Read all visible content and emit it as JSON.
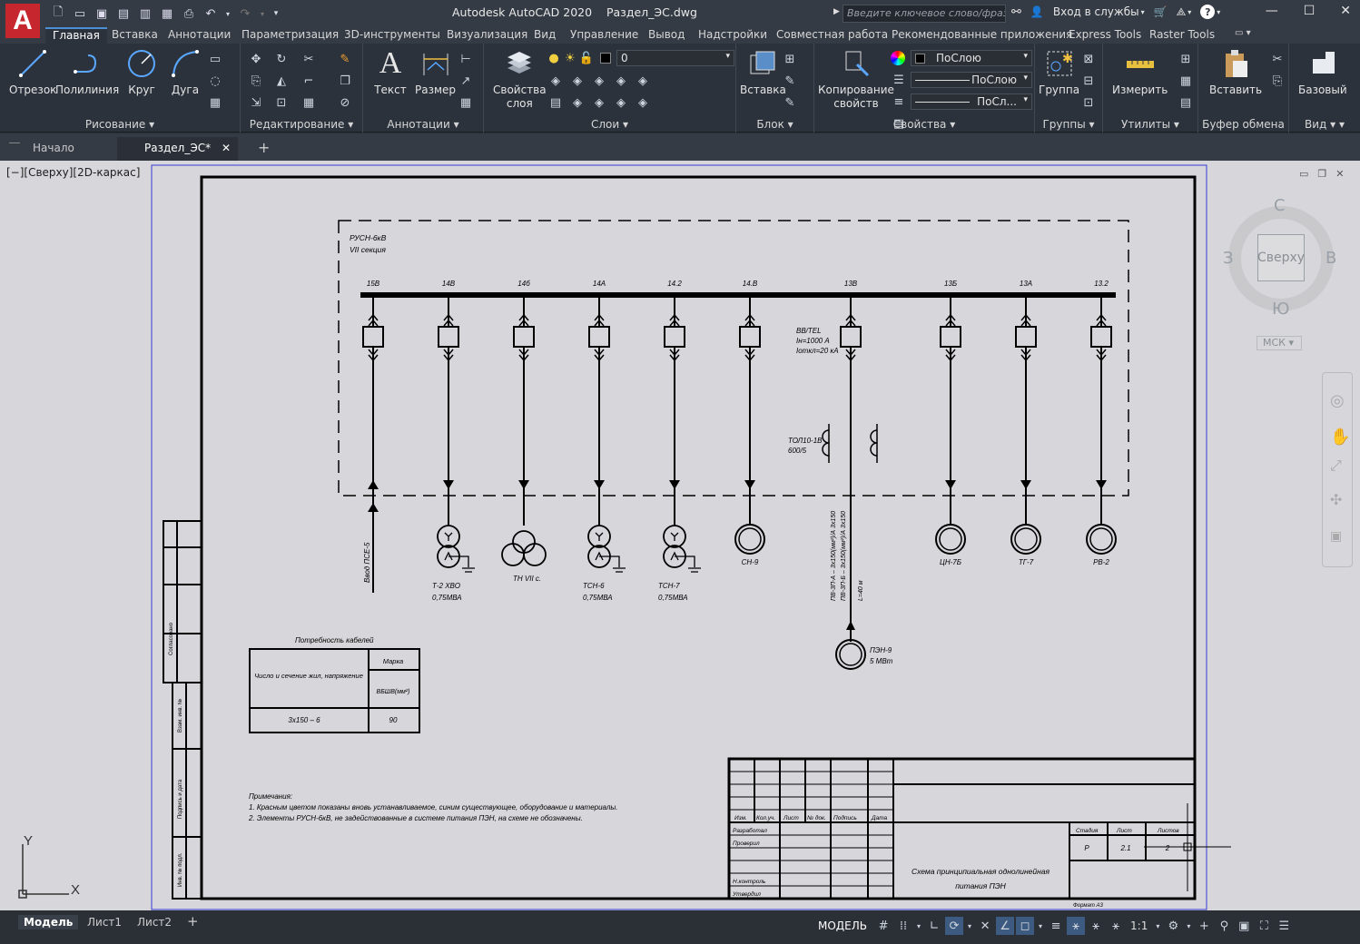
{
  "app": {
    "logo_letter": "A",
    "title": "Autodesk AutoCAD 2020    Раздел_ЭС.dwg",
    "search_placeholder": "Введите ключевое слово/фразу",
    "sign_in": "Вход в службы",
    "help": "?"
  },
  "ribbon_tabs": [
    "Главная",
    "Вставка",
    "Аннотации",
    "Параметризация",
    "3D-инструменты",
    "Визуализация",
    "Вид",
    "Управление",
    "Вывод",
    "Надстройки",
    "Совместная работа",
    "Рекомендованные приложения",
    "Express Tools",
    "Raster Tools"
  ],
  "panels": {
    "draw": {
      "title": "Рисование",
      "buttons": [
        "Отрезок",
        "Полилиния",
        "Круг",
        "Дуга"
      ]
    },
    "modify": {
      "title": "Редактирование"
    },
    "annotation": {
      "title": "Аннотации",
      "buttons": [
        "Текст",
        "Размер"
      ]
    },
    "layers": {
      "title": "Слои",
      "button": "Свойства\nслоя",
      "layer_current": "0"
    },
    "block": {
      "title": "Блок",
      "button": "Вставка"
    },
    "properties": {
      "title": "Свойства",
      "button": "Копирование\nсвойств",
      "color": "ПоСлою",
      "linetype": "ПоСлою",
      "lineweight": "ПоСл..."
    },
    "groups": {
      "title": "Группы",
      "button": "Группа"
    },
    "utilities": {
      "title": "Утилиты",
      "button": "Измерить"
    },
    "clipboard": {
      "title": "Буфер обмена",
      "button": "Вставить"
    },
    "view": {
      "title": "Вид",
      "button": "Базовый"
    }
  },
  "doc_tabs": [
    "Начало",
    "Раздел_ЭС*"
  ],
  "viewport": {
    "label": "[−][Сверху][2D-каркас]"
  },
  "viewcube": {
    "top": "Сверху",
    "north": "С",
    "south": "Ю",
    "west": "З",
    "east": "В",
    "ucs": "МСК"
  },
  "ucs_icon": {
    "x": "X",
    "y": "Y"
  },
  "drawing": {
    "switchgear": {
      "name": "РУСН-6кВ",
      "section": "VII секция"
    },
    "cells": [
      "15В",
      "14В",
      "14б",
      "14А",
      "14.2",
      "14.В",
      "13В",
      "13Б",
      "13А",
      "13.2"
    ],
    "breaker_note": [
      "ВВ/TEL",
      "Iн=1000 А",
      "Iоткл=20 кА"
    ],
    "ct_label": [
      "ТОЛ10-1В",
      "600/5"
    ],
    "cable_label": [
      "ПВ-3П-А – 3х150(мм²)/А 3х150",
      "ПВ-3П-Б – 3х150(мм²)/А 3х150",
      "L=40 м"
    ],
    "feeders": [
      {
        "id": "f1",
        "label": "Ввод ПСЕ-5"
      },
      {
        "id": "f2",
        "label": "Т-2 ХВО",
        "sub": "0,75МВА"
      },
      {
        "id": "f3",
        "label": "ТН VII с."
      },
      {
        "id": "f4",
        "label": "ТСН-6",
        "sub": "0,75МВА"
      },
      {
        "id": "f5",
        "label": "ТСН-7",
        "sub": "0,75МВА"
      },
      {
        "id": "f6",
        "label": "СН-9"
      },
      {
        "id": "f8",
        "label": "ЦН-7Б"
      },
      {
        "id": "f9",
        "label": "ТГ-7"
      },
      {
        "id": "f10",
        "label": "РВ-2"
      }
    ],
    "motor": {
      "label": "ПЭН-9",
      "sub": "5 МВт"
    },
    "table": {
      "title": "Потребность кабелей",
      "h1": "Число и сечение жил, напряжение",
      "h2": "Марка",
      "h2sub": "ВБШВ(мм²)",
      "r1": "3х150 – 6",
      "r2": "90"
    },
    "notes": {
      "title": "Примечания:",
      "l1": "1. Красным цветом показаны вновь устанавливаемое, синим существующее, оборудование и материалы.",
      "l2": "2. Элементы РУСН-6кВ, не задействованные в системе питания ПЭН, на схеме не обозначены."
    },
    "stamp": {
      "headers": [
        "Изм.",
        "Кол.уч.",
        "Лист",
        "№ док.",
        "Подпись",
        "Дата"
      ],
      "roles": [
        "Разработал",
        "Проверил",
        "Н.контроль",
        "Утвердил"
      ],
      "stage_h": "Стадия",
      "sheet_h": "Лист",
      "sheets_h": "Листов",
      "stage": "Р",
      "sheet": "2.1",
      "sheets": "2",
      "title": "Схема принципиальная однолинейная питания ПЭН",
      "format": "Формат А3"
    },
    "side_labels": [
      "Согласовано",
      "Взам. инв. №",
      "Подпись и дата",
      "Инв. № подл."
    ]
  },
  "layout_tabs": [
    "Модель",
    "Лист1",
    "Лист2"
  ],
  "status": {
    "model": "МОДЕЛЬ",
    "scale": "1:1"
  }
}
